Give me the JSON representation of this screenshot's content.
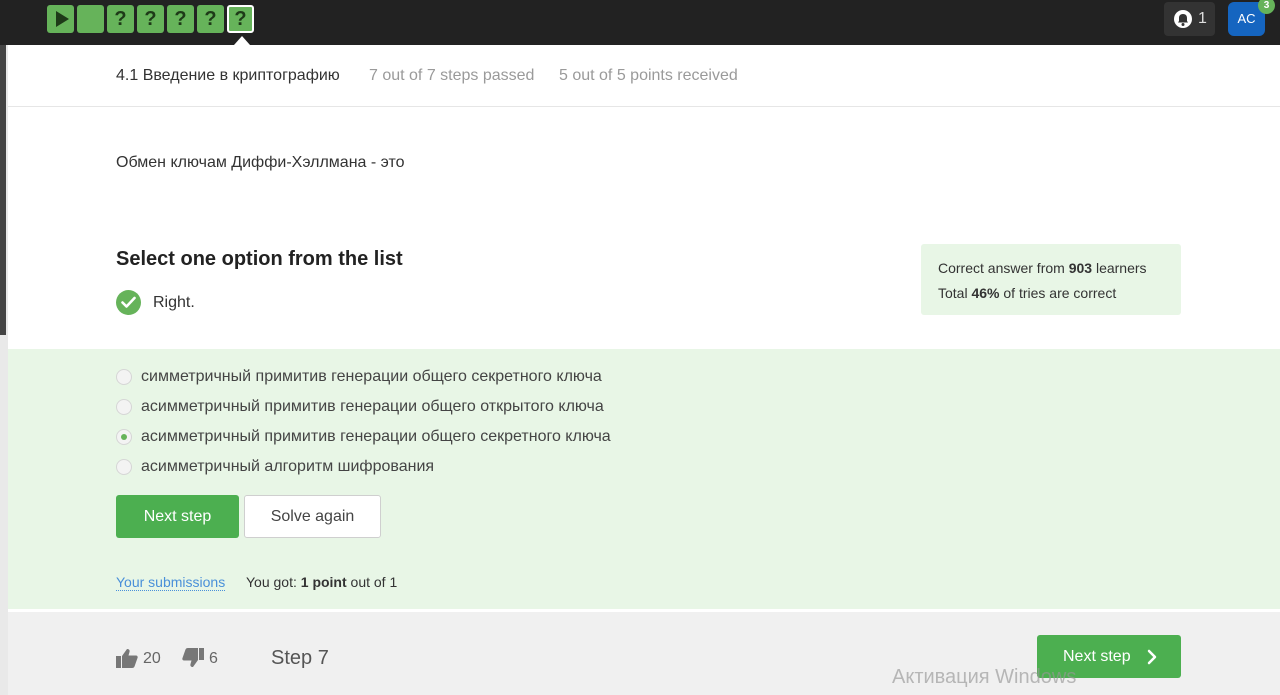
{
  "progress_steps": [
    {
      "status": "play"
    },
    {
      "status": "passed",
      "label": ""
    },
    {
      "status": "unknown",
      "label": "?"
    },
    {
      "status": "unknown",
      "label": "?"
    },
    {
      "status": "unknown",
      "label": "?"
    },
    {
      "status": "unknown",
      "label": "?"
    },
    {
      "status": "current",
      "label": "?"
    }
  ],
  "notifications": {
    "count": "1"
  },
  "user": {
    "initials": "AC",
    "badge": "3"
  },
  "header": {
    "lesson_title": "4.1 Введение в криптографию",
    "steps_passed": "7 out of 7 steps passed",
    "points_received": "5 out of 5 points  received"
  },
  "question": {
    "text": "Обмен ключам Диффи-Хэллмана - это"
  },
  "quiz": {
    "heading": "Select one option from the list",
    "status": "Right.",
    "options": [
      {
        "label": "симметричный примитив генерации общего секретного ключа",
        "selected": false
      },
      {
        "label": "асимметричный примитив генерации общего открытого ключа",
        "selected": false
      },
      {
        "label": "асимметричный примитив генерации общего секретного ключа",
        "selected": true
      },
      {
        "label": "асимметричный алгоритм шифрования",
        "selected": false
      }
    ],
    "next_label": "Next step",
    "solve_again_label": "Solve again",
    "submissions_link": "Your submissions",
    "you_got_prefix": "You got: ",
    "you_got_points": "1 point",
    "you_got_suffix": " out of 1"
  },
  "stats": {
    "line1_prefix": "Correct answer from ",
    "learners": "903",
    "line1_suffix": " learners",
    "line2_prefix": "Total ",
    "percent": "46%",
    "line2_suffix": " of tries are correct"
  },
  "footer": {
    "likes": "20",
    "dislikes": "6",
    "step_label": "Step 7",
    "next_label": "Next step"
  },
  "watermark": "Активация Windows",
  "colors": {
    "accent": "#4caf50",
    "answer_bg": "#e8f6e6",
    "topbar": "#222222",
    "avatar": "#1565c0"
  }
}
